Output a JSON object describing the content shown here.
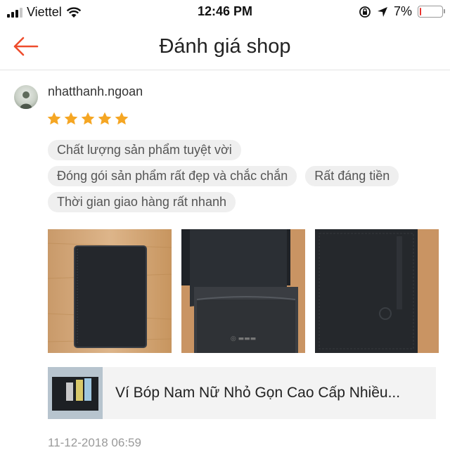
{
  "status_bar": {
    "carrier": "Viettel",
    "time": "12:46 PM",
    "battery_percent": "7%",
    "battery_level": 0.07
  },
  "header": {
    "title": "Đánh giá shop"
  },
  "review": {
    "username": "nhatthanh.ngoan",
    "rating": 5,
    "max_rating": 5,
    "tags_row1": [
      "Chất lượng sản phẩm tuyệt vời"
    ],
    "tags_row2": [
      "Đóng gói sản phẩm rất đẹp và chắc chắn",
      "Rất đáng tiền"
    ],
    "tags_row3": [
      "Thời gian giao hàng rất nhanh"
    ],
    "product_name": "Ví Bóp Nam Nữ Nhỏ Gọn Cao Cấp Nhiều...",
    "timestamp": "11-12-2018 06:59"
  },
  "colors": {
    "accent": "#ee4d2d",
    "star": "#f5a623",
    "tag_bg": "#efefef",
    "battery_low": "#e8342f"
  }
}
